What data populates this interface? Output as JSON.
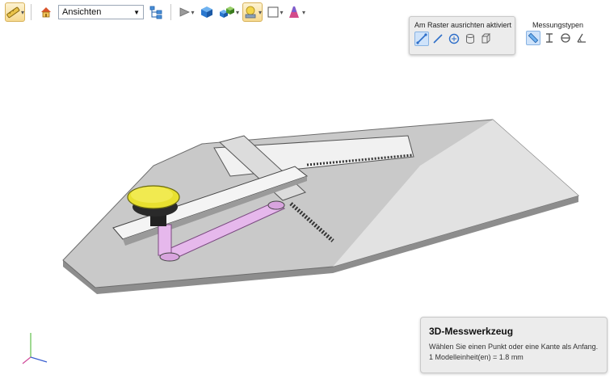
{
  "toolbar": {
    "views_label": "Ansichten",
    "items": [
      "measure-tool",
      "home",
      "views-select",
      "view-tree",
      "play",
      "shaded-box",
      "display-mode",
      "lighting",
      "background",
      "appearance"
    ]
  },
  "measure_panel": {
    "snap_label": "Am Raster ausrichten aktiviert",
    "types_label": "Messungstypen"
  },
  "info": {
    "title": "3D-Messwerkzeug",
    "instruction": "Wählen Sie einen Punkt oder eine Kante als Anfang.",
    "scale": "1 Modelleinheit(en) = 1.8 mm"
  },
  "colors": {
    "accent": "#2f6fc9",
    "highlight": "#f6d98f",
    "plate": "#c8c8c8",
    "knob": "#e8e030",
    "arm": "#e6b8ec"
  }
}
